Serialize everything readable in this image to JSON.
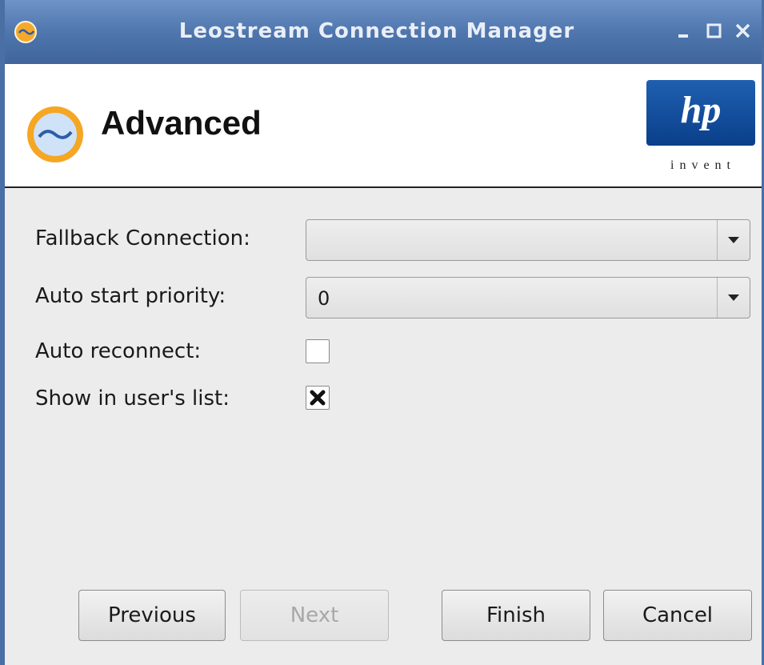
{
  "window": {
    "title": "Leostream Connection Manager",
    "minimize_glyph": "_",
    "maximize_glyph": "□",
    "close_glyph": "X"
  },
  "header": {
    "title": "Advanced",
    "logo_text": "hp",
    "logo_tagline": "invent"
  },
  "form": {
    "fallback_label": "Fallback Connection:",
    "fallback_value": "",
    "auto_start_label": "Auto start priority:",
    "auto_start_value": "0",
    "auto_reconnect_label": "Auto reconnect:",
    "auto_reconnect_checked": false,
    "show_in_list_label": "Show in user's list:",
    "show_in_list_checked": true
  },
  "buttons": {
    "previous": "Previous",
    "next": "Next",
    "next_enabled": false,
    "finish": "Finish",
    "cancel": "Cancel"
  },
  "colors": {
    "titlebar": "#4d74ab",
    "accent_orange": "#f5a623",
    "hp_blue": "#0a3f8a"
  }
}
